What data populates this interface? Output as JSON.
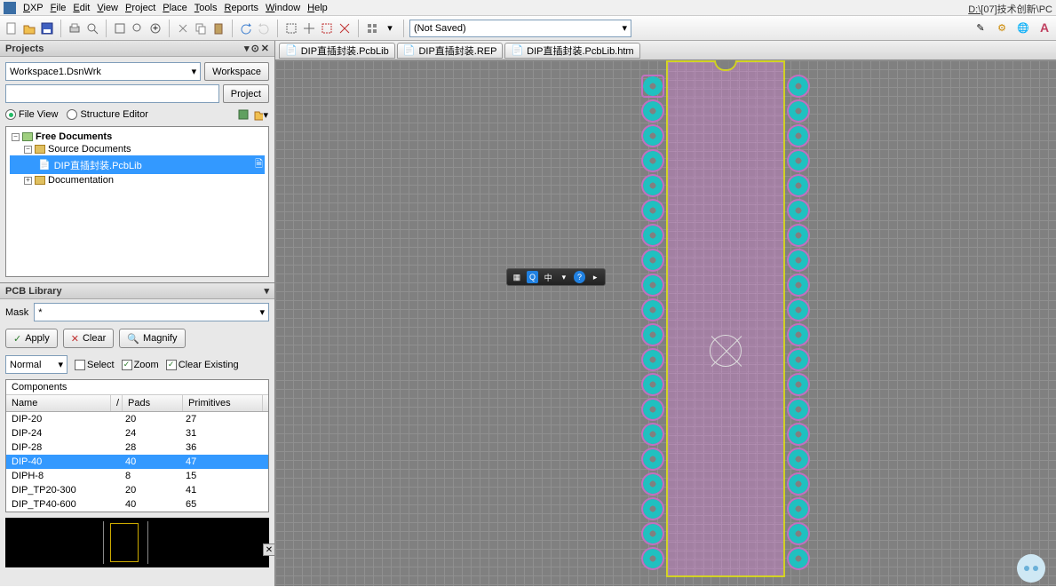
{
  "menu": {
    "items": [
      "DXP",
      "File",
      "Edit",
      "View",
      "Project",
      "Place",
      "Tools",
      "Reports",
      "Window",
      "Help"
    ],
    "path": "D:\\[07]技术创新\\PC"
  },
  "toolbar": {
    "not_saved": "(Not Saved)"
  },
  "projects": {
    "title": "Projects",
    "workspace": "Workspace1.DsnWrk",
    "workspace_btn": "Workspace",
    "project_btn": "Project",
    "fileview": "File View",
    "structure": "Structure Editor",
    "tree": {
      "root": "Free Documents",
      "src": "Source Documents",
      "file": "DIP直插封装.PcbLib",
      "doc": "Documentation"
    }
  },
  "pcblib": {
    "title": "PCB Library",
    "mask": "Mask",
    "mask_val": "*",
    "apply": "Apply",
    "clear": "Clear",
    "magnify": "Magnify",
    "normal": "Normal",
    "select": "Select",
    "zoom": "Zoom",
    "clear_existing": "Clear Existing",
    "components_label": "Components",
    "columns": [
      "Name",
      "Pads",
      "Primitives"
    ],
    "rows": [
      {
        "name": "DIP-20",
        "pads": "20",
        "prim": "27",
        "sel": false
      },
      {
        "name": "DIP-24",
        "pads": "24",
        "prim": "31",
        "sel": false
      },
      {
        "name": "DIP-28",
        "pads": "28",
        "prim": "36",
        "sel": false
      },
      {
        "name": "DIP-40",
        "pads": "40",
        "prim": "47",
        "sel": true
      },
      {
        "name": "DIPH-8",
        "pads": "8",
        "prim": "15",
        "sel": false
      },
      {
        "name": "DIP_TP20-300",
        "pads": "20",
        "prim": "41",
        "sel": false
      },
      {
        "name": "DIP_TP40-600",
        "pads": "40",
        "prim": "65",
        "sel": false
      }
    ]
  },
  "tabs": [
    "DIP直插封装.PcbLib",
    "DIP直插封装.REP",
    "DIP直插封装.PcbLib.htm"
  ],
  "ime": {
    "center": "中"
  },
  "chart_data": {
    "type": "table",
    "title": "PCB Library Components",
    "columns": [
      "Name",
      "Pads",
      "Primitives"
    ],
    "rows": [
      [
        "DIP-20",
        20,
        27
      ],
      [
        "DIP-24",
        24,
        31
      ],
      [
        "DIP-28",
        28,
        36
      ],
      [
        "DIP-40",
        40,
        47
      ],
      [
        "DIPH-8",
        8,
        15
      ],
      [
        "DIP_TP20-300",
        20,
        41
      ],
      [
        "DIP_TP40-600",
        40,
        65
      ]
    ]
  }
}
